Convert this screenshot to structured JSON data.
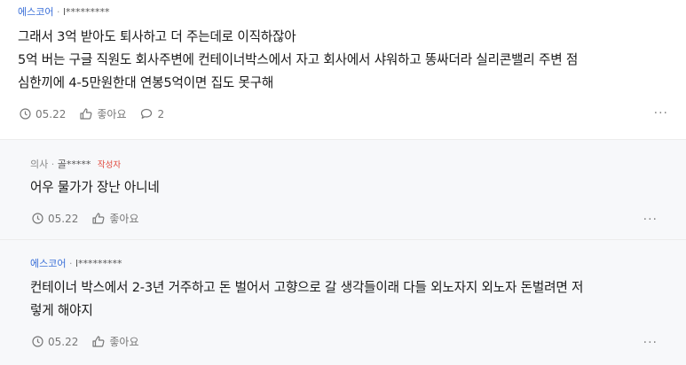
{
  "comments": [
    {
      "company": "에스코어",
      "separator": "·",
      "user": "l*********",
      "badge": "",
      "lines": [
        "그래서 3억 받아도 퇴사하고 더 주는데로 이직하잖아",
        "5억 버는 구글 직원도 회사주변에 컨테이너박스에서 자고 회사에서 샤워하고 똥싸더라 실리콘밸리 주변 점",
        "심한끼에 4-5만원한대 연봉5억이면 집도 못구해"
      ],
      "date": "05.22",
      "like_label": "좋아요",
      "reply_count": "2",
      "more_label": "···"
    },
    {
      "company": "의사",
      "separator": "·",
      "user": "골*****",
      "badge": "작성자",
      "lines": [
        "어우 물가가 장난 아니네"
      ],
      "date": "05.22",
      "like_label": "좋아요",
      "more_label": "···"
    },
    {
      "company": "에스코어",
      "separator": "·",
      "user": "l*********",
      "badge": "",
      "lines": [
        "컨테이너 박스에서 2-3년 거주하고 돈 벌어서 고향으로 갈 생각들이래 다들 외노자지 외노자 돈벌려면 저",
        "렇게 해야지"
      ],
      "date": "05.22",
      "like_label": "좋아요",
      "more_label": "···"
    }
  ],
  "colors": {
    "company_link": "#3a6fd8",
    "author_badge": "#e0463a",
    "reply_bg": "#f7f8fa"
  }
}
